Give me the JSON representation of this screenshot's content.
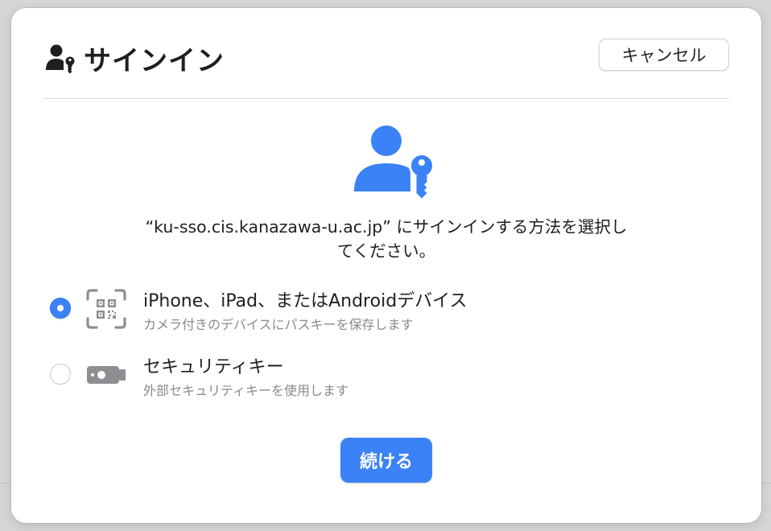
{
  "dialog": {
    "title": "サインイン",
    "cancel_label": "キャンセル",
    "prompt_line1": "“ku-sso.cis.kanazawa-u.ac.jp” にサインインする方法を選択し",
    "prompt_line2": "てください。",
    "continue_label": "続ける"
  },
  "options": [
    {
      "title": "iPhone、iPad、またはAndroidデバイス",
      "subtitle": "カメラ付きのデバイスにパスキーを保存します",
      "selected": true,
      "icon": "qr-code-scan-icon"
    },
    {
      "title": "セキュリティキー",
      "subtitle": "外部セキュリティキーを使用します",
      "selected": false,
      "icon": "usb-security-key-icon"
    }
  ],
  "colors": {
    "accent": "#3b82f6",
    "icon_gray": "#8e8e93",
    "header_icon": "#1f1f1f"
  }
}
